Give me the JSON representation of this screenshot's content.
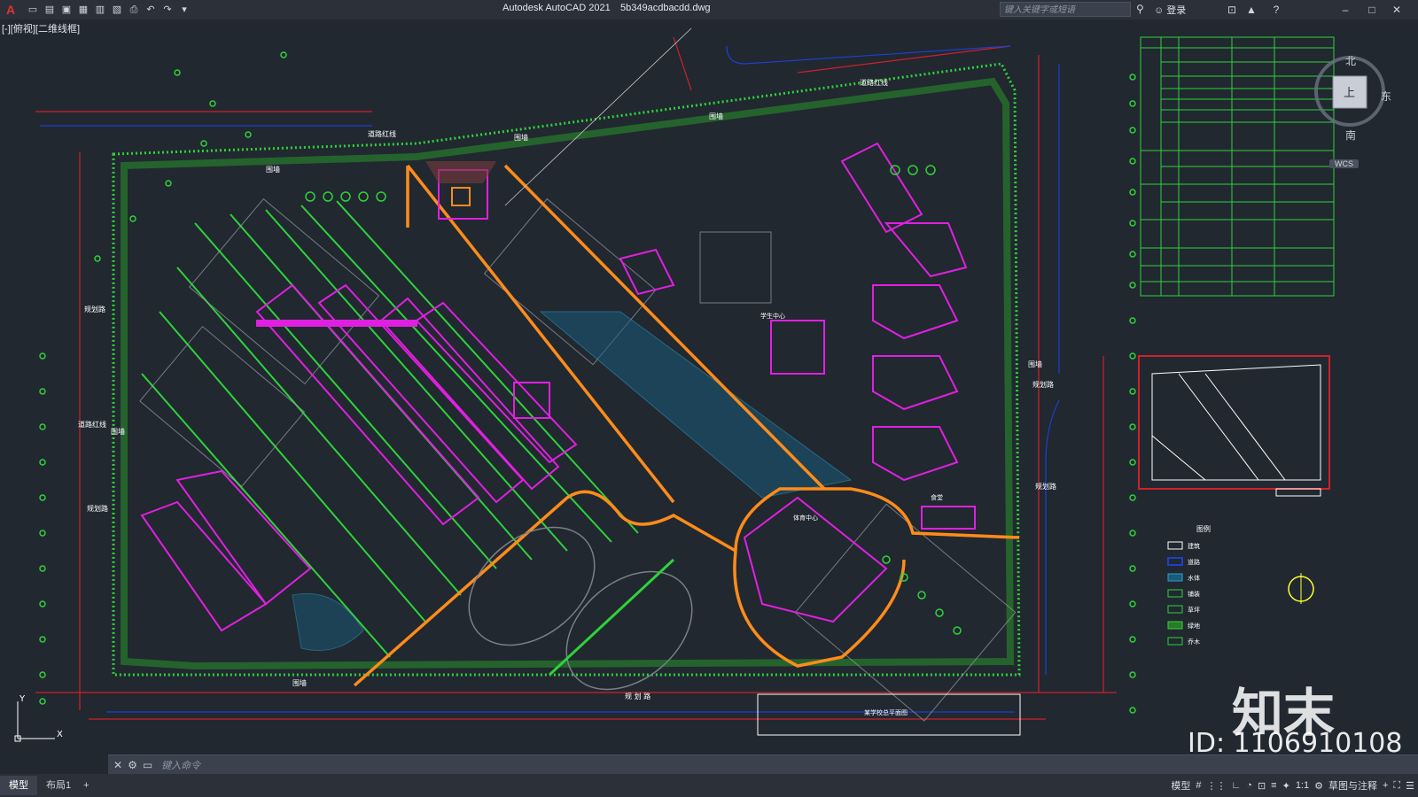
{
  "app": {
    "title": "Autodesk AutoCAD 2021",
    "document": "5b349acdbacdd.dwg",
    "search_placeholder": "键入关键字或短语",
    "login": "登录"
  },
  "viewport": {
    "label": "[-][俯视][二维线框]"
  },
  "viewcube": {
    "top": "上",
    "north": "北",
    "south": "南",
    "east": "东",
    "wcs": "WCS"
  },
  "drawing_labels": {
    "road_red_line_1": "道路红线",
    "road_red_line_2": "道路红线",
    "road_red_line_3": "道路红线",
    "wall_1": "围墙",
    "wall_2": "围墙",
    "wall_3": "围墙",
    "wall_4": "围墙",
    "wall_5": "围墙",
    "wall_6": "围墙",
    "plan_road_bottom": "规 划 路",
    "plan_road_left": "规划路",
    "plan_road_left2": "规划路",
    "plan_road_right": "规划路",
    "plan_road_right2": "规划路",
    "sports_center": "体育中心",
    "dining": "食堂",
    "student_center": "学生中心",
    "legend_title": "图例",
    "legend_items": [
      "建筑",
      "道路",
      "水体",
      "铺装",
      "草坪",
      "绿地",
      "乔木"
    ],
    "title_block_text": "某学校总平面图"
  },
  "commandline": {
    "placeholder": "键入命令"
  },
  "tabs": [
    "模型",
    "布局1"
  ],
  "status": {
    "model": "模型",
    "scale": "1:1",
    "workspace": "草图与注释"
  },
  "watermark": {
    "logo": "知末",
    "id": "ID: 1106910108"
  },
  "colors": {
    "background": "#212830",
    "accent_red": "#e3322f",
    "cad_green": "#2fd23a",
    "cad_magenta": "#e020e0",
    "cad_orange": "#ff8c1a",
    "cad_red": "#d0202a"
  }
}
